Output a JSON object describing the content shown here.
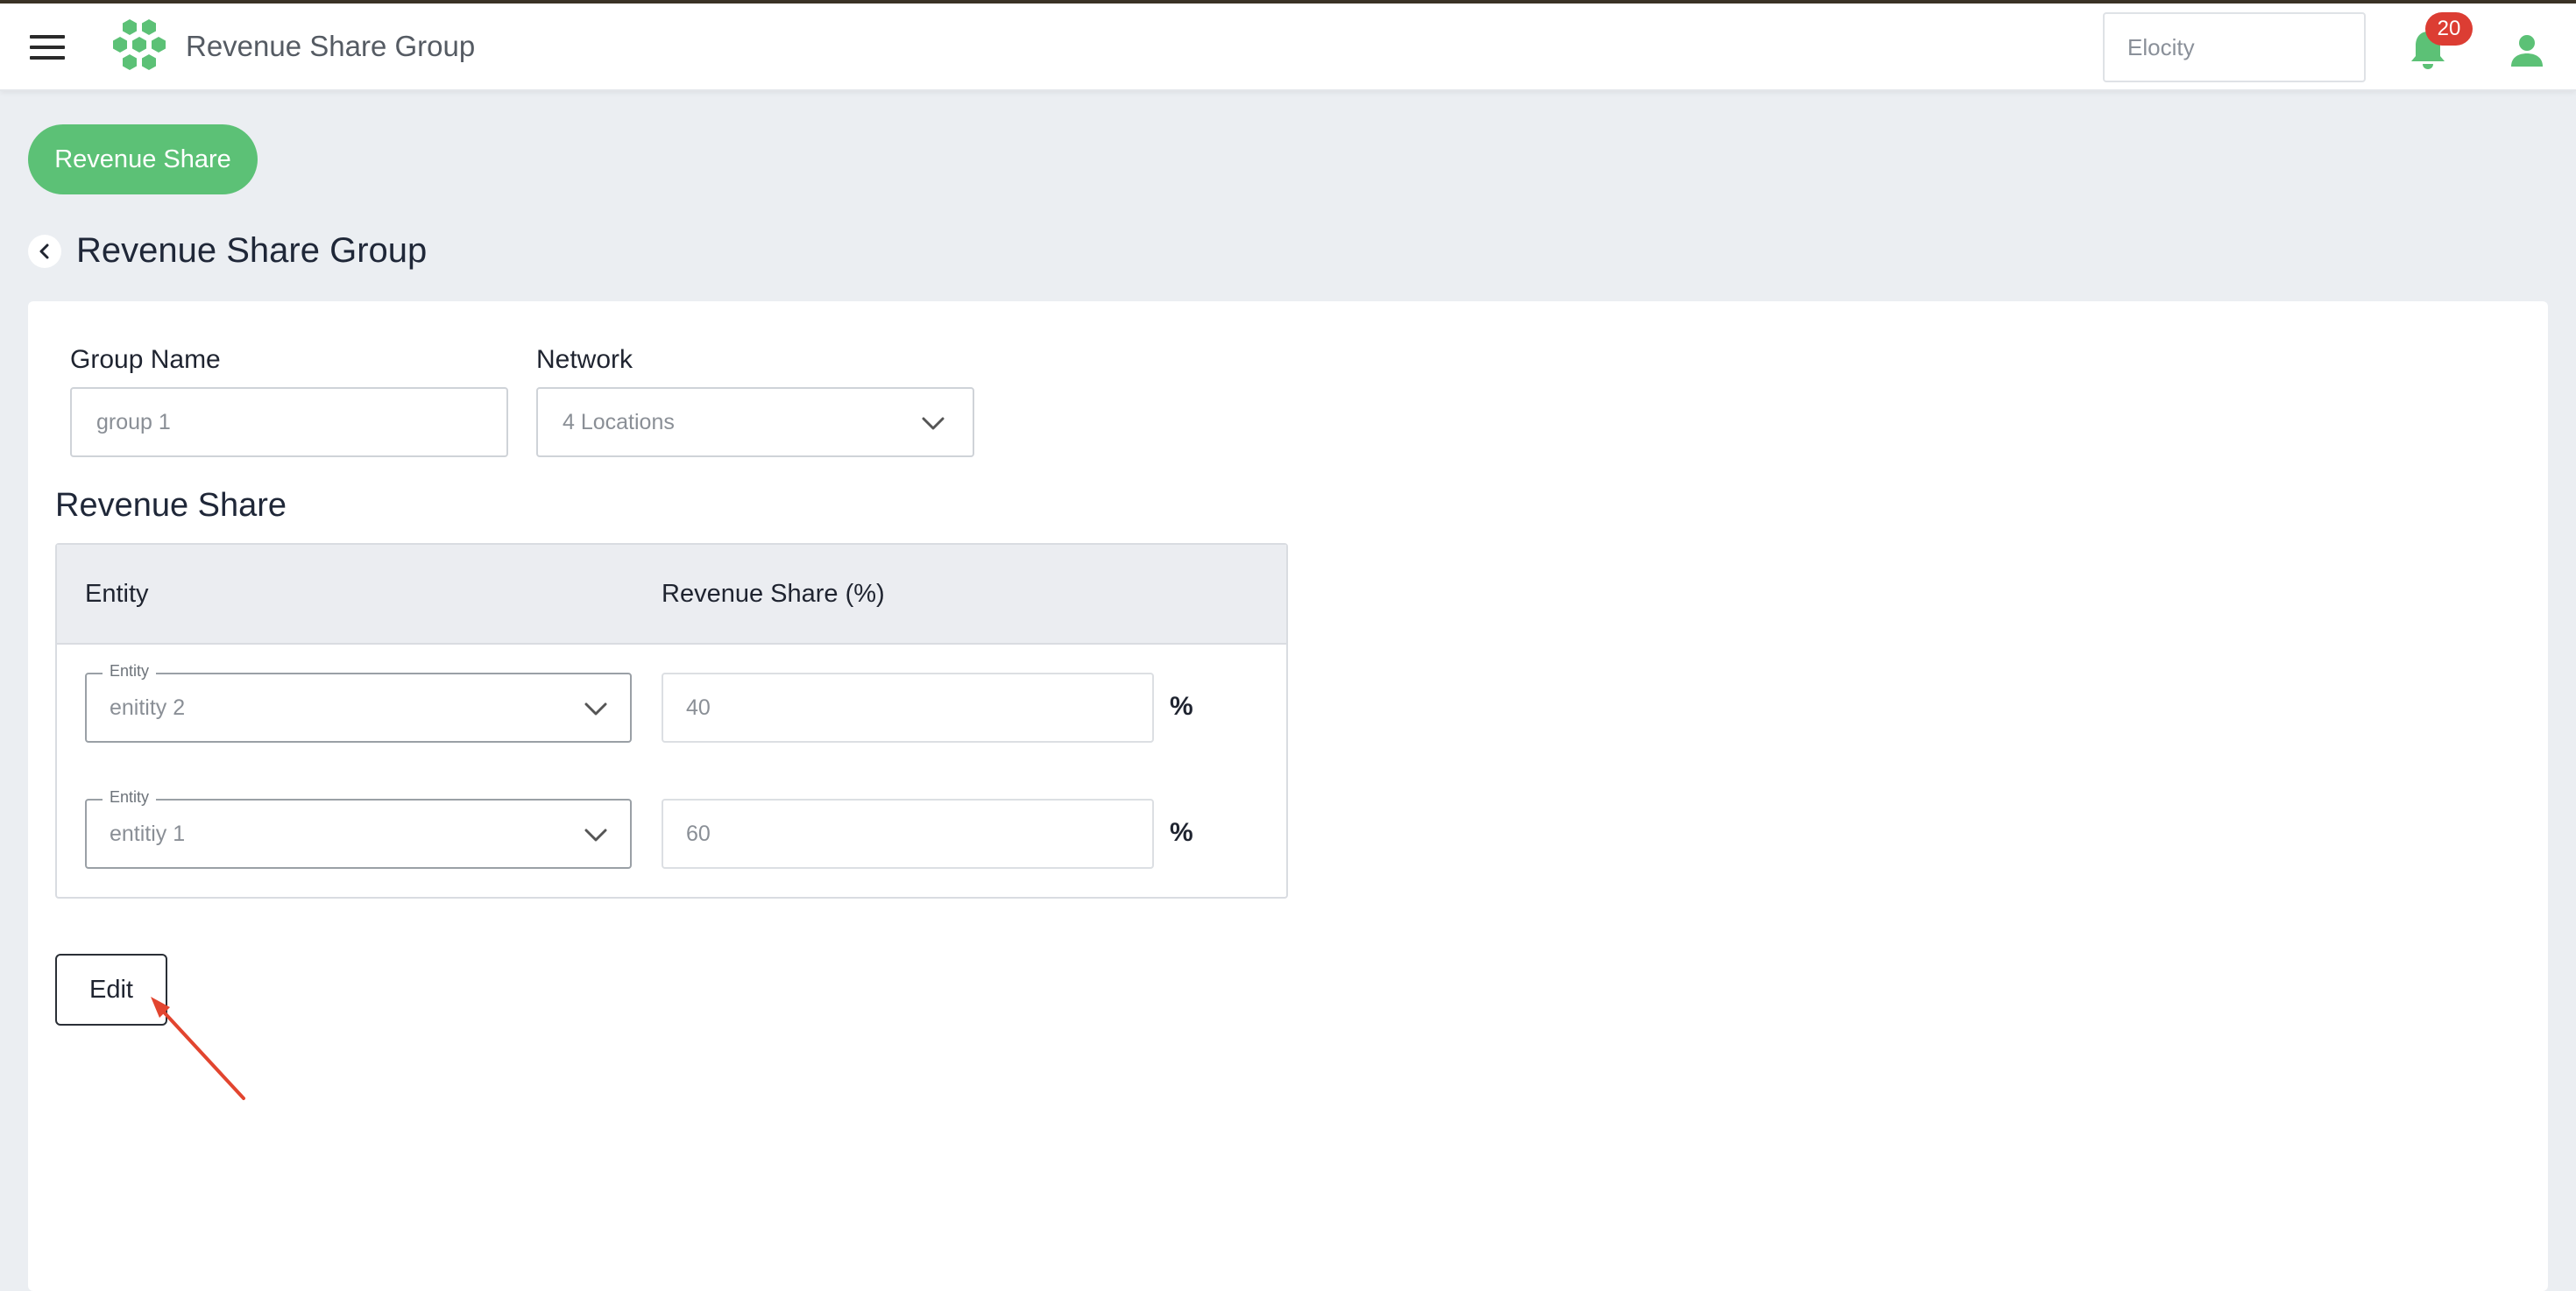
{
  "header": {
    "title": "Revenue Share Group",
    "org_placeholder": "Elocity",
    "notification_count": "20"
  },
  "nav": {
    "revenue_share_button": "Revenue Share"
  },
  "page": {
    "title": "Revenue Share Group"
  },
  "form": {
    "group_name_label": "Group Name",
    "group_name_value": "group 1",
    "network_label": "Network",
    "network_value": "4 Locations"
  },
  "revenue_share": {
    "section_title": "Revenue Share",
    "columns": [
      "Entity",
      "Revenue Share (%)"
    ],
    "rows": [
      {
        "entity_label": "Entity",
        "entity": "enitity 2",
        "share": "40",
        "unit": "%"
      },
      {
        "entity_label": "Entity",
        "entity": "entitiy 1",
        "share": "60",
        "unit": "%"
      }
    ]
  },
  "actions": {
    "edit_label": "Edit"
  },
  "colors": {
    "brand_green": "#5cc176",
    "badge_red": "#dc3d33",
    "annotation_arrow": "#e2452f"
  },
  "icons": {
    "menu": "hamburger-icon",
    "logo": "hexagon-cluster-logo",
    "notifications": "bell-icon",
    "user": "user-icon",
    "back": "chevron-left-icon",
    "dropdown": "chevron-down-icon"
  }
}
